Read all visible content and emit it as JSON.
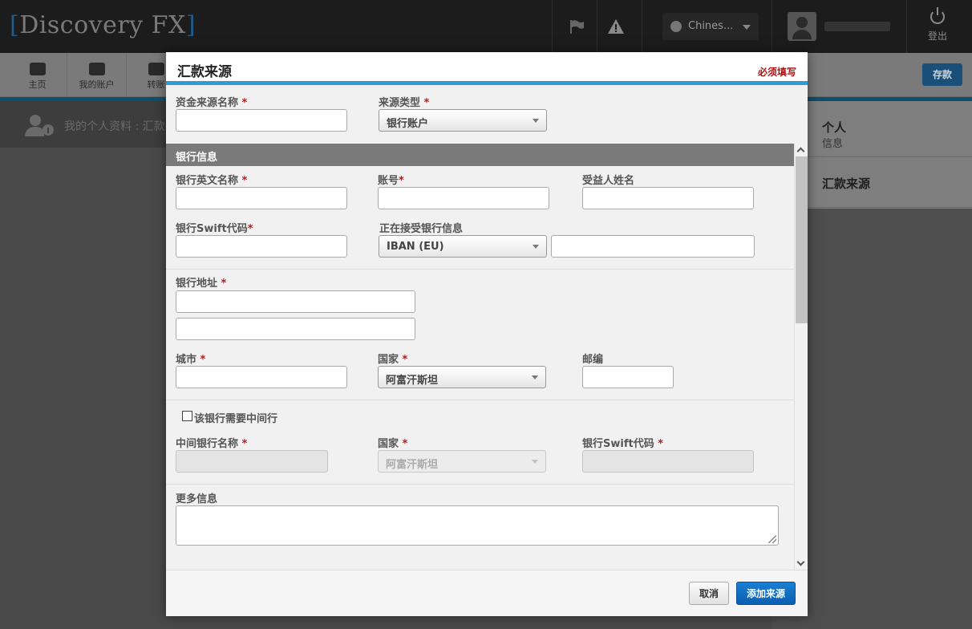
{
  "app": {
    "logo_text": "Discovery FX",
    "language": "Chines...",
    "logout_label": "登出",
    "nav": [
      {
        "label": "主页"
      },
      {
        "label": "我的账户"
      },
      {
        "label": "转账"
      }
    ],
    "save_label": "存款",
    "profile_breadcrumb": "我的个人资料 : 汇款来源",
    "right_panel": {
      "item1_title": "个人",
      "item1_subtitle": "信息",
      "item2_title": "汇款来源"
    }
  },
  "modal": {
    "title": "汇款来源",
    "required_note": "必须填写",
    "required_mark": "*",
    "fields": {
      "source_name": {
        "label": "资金来源名称",
        "value": ""
      },
      "source_type": {
        "label": "来源类型",
        "value": "银行账户"
      },
      "bank_section_title": "银行信息",
      "bank_name_en": {
        "label": "银行英文名称",
        "value": ""
      },
      "account_no": {
        "label": "账号",
        "value": ""
      },
      "beneficiary": {
        "label": "受益人姓名",
        "value": ""
      },
      "swift": {
        "label": "银行Swift代码",
        "value": ""
      },
      "receiving_info": {
        "label": "正在接受银行信息",
        "value": "IBAN (EU)",
        "extra_value": ""
      },
      "bank_address": {
        "label": "银行地址",
        "line1": "",
        "line2": ""
      },
      "city": {
        "label": "城市",
        "value": ""
      },
      "country": {
        "label": "国家",
        "value": "阿富汗斯坦"
      },
      "postcode": {
        "label": "邮编",
        "value": ""
      },
      "intermediary_check": {
        "label": "该银行需要中间行",
        "checked": false
      },
      "intermediary_name": {
        "label": "中间银行名称",
        "value": ""
      },
      "intermediary_country": {
        "label": "国家",
        "value": "阿富汗斯坦"
      },
      "intermediary_swift": {
        "label": "银行Swift代码",
        "value": ""
      },
      "more_info": {
        "label": "更多信息",
        "value": ""
      }
    },
    "buttons": {
      "cancel": "取消",
      "add": "添加来源"
    }
  }
}
